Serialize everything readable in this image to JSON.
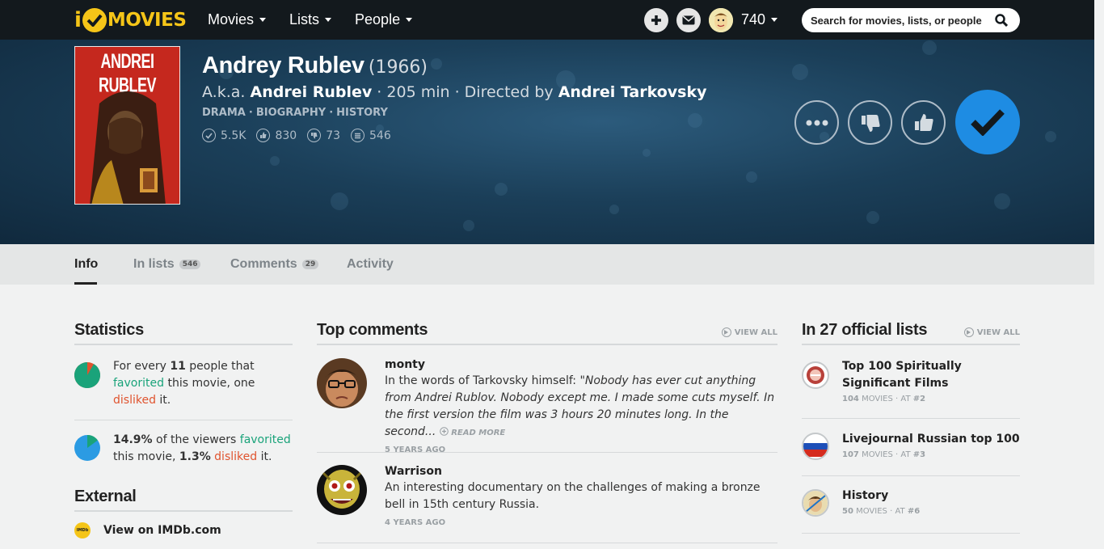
{
  "brand": {
    "logo_prefix": "i",
    "logo_word": "MOVIES"
  },
  "nav": [
    {
      "label": "Movies"
    },
    {
      "label": "Lists"
    },
    {
      "label": "People"
    }
  ],
  "user": {
    "points": "740"
  },
  "search": {
    "placeholder": "Search for movies, lists, or people"
  },
  "movie": {
    "poster_text": "ANDREI RUBLEV",
    "title": "Andrey Rublev",
    "year": "(1966)",
    "aka_prefix": "A.k.a.",
    "aka": "Andrei Rublev",
    "runtime": "205 min",
    "directed_prefix": "Directed by",
    "director": "Andrei Tarkovsky",
    "genres": [
      "DRAMA",
      "BIOGRAPHY",
      "HISTORY"
    ],
    "stats": {
      "seen": "5.5K",
      "favorites": "830",
      "dislikes": "73",
      "lists": "546"
    }
  },
  "tabs": [
    {
      "label": "Info",
      "badge": ""
    },
    {
      "label": "In lists",
      "badge": "546"
    },
    {
      "label": "Comments",
      "badge": "29"
    },
    {
      "label": "Activity",
      "badge": ""
    }
  ],
  "statistics": {
    "heading": "Statistics",
    "item1": {
      "pre": "For every",
      "num": "11",
      "mid1": "people that",
      "fav": "favorited",
      "mid2": "this movie, one",
      "dis": "disliked",
      "post": "it."
    },
    "item2": {
      "pct_fav": "14.9%",
      "mid1": "of the viewers",
      "fav": "favorited",
      "mid2": "this movie,",
      "pct_dis": "1.3%",
      "dis": "disliked",
      "post": "it."
    },
    "pie1_fav_fraction": 0.917,
    "pie2_fav_fraction": 0.149,
    "colors": {
      "fav": "#1aa37a",
      "dis": "#e0542f",
      "viewers": "#2b9be3"
    }
  },
  "external": {
    "heading": "External",
    "imdb_label": "View on IMDb.com",
    "imdb_icon_text": "IMDb"
  },
  "top_comments": {
    "heading": "Top comments",
    "view_all": "VIEW ALL",
    "items": [
      {
        "user": "monty",
        "text_plain": "In the words of Tarkovsky himself: ",
        "text_quote": "\"Nobody has ever cut anything from Andrei Rublov. Nobody except me. I made some cuts myself. In the first version the film was 3 hours 20 minutes long. In the second...",
        "read_more": "READ MORE",
        "time": "5 YEARS AGO"
      },
      {
        "user": "Warrison",
        "text_plain": "An interesting documentary on the challenges of making a bronze bell in 15th century Russia.",
        "time": "4 YEARS AGO"
      }
    ]
  },
  "official_lists": {
    "heading": "In 27 official lists",
    "view_all": "VIEW ALL",
    "items": [
      {
        "title": "Top 100 Spiritually Significant Films",
        "count": "104",
        "count_label": "MOVIES",
        "at_label": "AT",
        "rank": "#2"
      },
      {
        "title": "Livejournal Russian top 100",
        "count": "107",
        "count_label": "MOVIES",
        "at_label": "AT",
        "rank": "#3"
      },
      {
        "title": "History",
        "count": "50",
        "count_label": "MOVIES",
        "at_label": "AT",
        "rank": "#6"
      }
    ]
  }
}
